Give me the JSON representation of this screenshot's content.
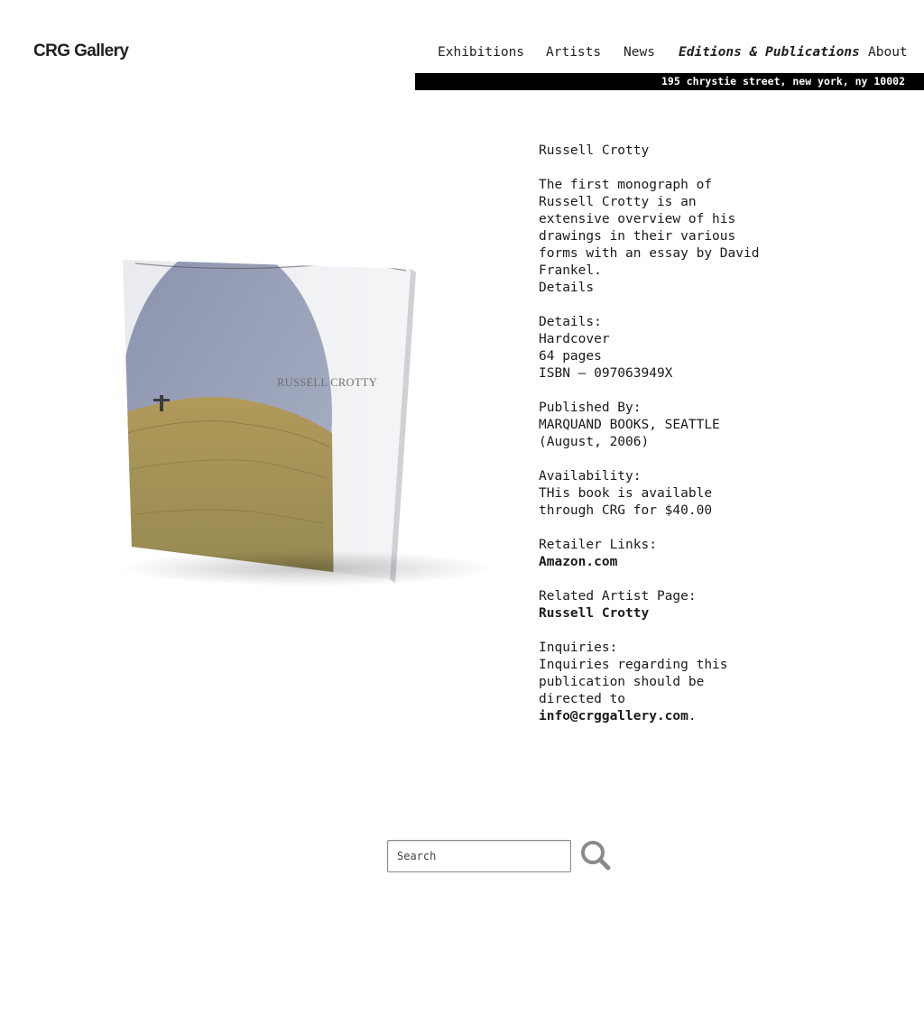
{
  "brand": {
    "logo_text": "CRG Gallery"
  },
  "nav": {
    "items": [
      {
        "label": "Exhibitions"
      },
      {
        "label": "Artists"
      },
      {
        "label": "News"
      },
      {
        "label": "Editions & Publications",
        "active": true
      },
      {
        "label": "About"
      }
    ]
  },
  "address": "195 chrystie street, new york, ny 10002",
  "book": {
    "cover_title": "RUSSELL CROTTY",
    "artist": "Russell Crotty",
    "description": "The first monograph of Russell Crotty is an extensive overview of his drawings in their various forms with an essay by David Frankel.",
    "details_link": "Details",
    "details_heading": "Details:",
    "binding": "Hardcover",
    "pages": "64 pages",
    "isbn": "ISBN — 097063949X",
    "published_heading": "Published By:",
    "publisher": "MARQUAND BOOKS, SEATTLE",
    "publish_date": "(August, 2006)",
    "availability_heading": "Availability:",
    "availability_text": "THis book is available through CRG for $40.00",
    "retailer_heading": "Retailer Links:",
    "retailer_link": "Amazon.com",
    "related_heading": "Related Artist Page:",
    "related_link": "Russell Crotty",
    "inquiries_heading": "Inquiries:",
    "inquiries_text": "Inquiries regarding this publication should be directed to",
    "inquiries_email": "info@crggallery.com",
    "inquiries_period": "."
  },
  "search": {
    "placeholder": "Search"
  },
  "colors": {
    "address_bar_bg": "#000000",
    "text": "#1a1a1a"
  }
}
